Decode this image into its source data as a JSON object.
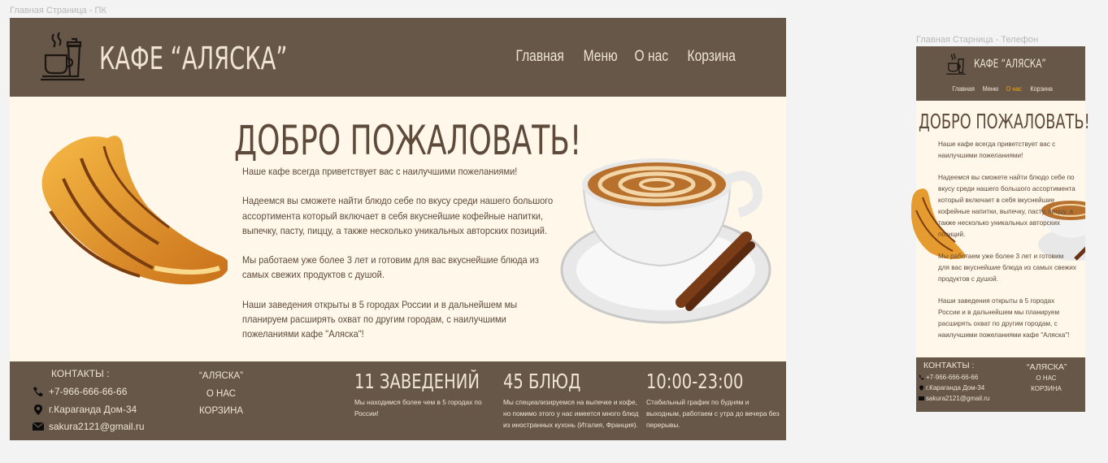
{
  "frames": {
    "pc_label": "Главная Страница - ПК",
    "phone_label": "Главная Старница - Телефон"
  },
  "header": {
    "title": "КАФЕ “АЛЯСКА”",
    "logo_icon": "cafe-logo-icon",
    "nav": [
      "Главная",
      "Меню",
      "О нас",
      "Корзина"
    ],
    "phone_active_nav": "О нас"
  },
  "main": {
    "welcome": "ДОБРО ПОЖАЛОВАТЬ!",
    "paragraphs": [
      "Наше кафе всегда приветствует вас с наилучшими пожеланиями!",
      "Надеемся вы сможете найти блюдо себе по вкусу среди нашего большого ассортимента который включает в себя вкуснейшие кофейные напитки, выпечку, пасту, пиццу, а также несколько уникальных авторских позиций.",
      "Мы работаем уже более 3 лет и готовим для вас вкуснейшие блюда из самых свежих продуктов с душой.",
      "Наши заведения открыты в 5 городах России и в дальнейшем мы планируем расширять охват по другим городам, с наилучшими пожеланиями кафе \"Аляска\"!"
    ]
  },
  "footer": {
    "contacts_title": "КОНТАКТЫ :",
    "phone": "+7-966-666-66-66",
    "address": "г.Караганда Дом-34",
    "email": "sakura2121@gmail.ru",
    "brand": "“АЛЯСКА”",
    "about": "О НАС",
    "cart": "КОРЗИНА",
    "stats": [
      {
        "title": "11 ЗАВЕДЕНИЙ",
        "desc": "Мы находимся более чем в 5 городах по России!"
      },
      {
        "title": "45 БЛЮД",
        "desc": "Мы специализируемся на выпечке и кофе, но помимо этого у нас имеется много блюд из иностранных кухонь (Италия, Франция)."
      },
      {
        "title": "10:00-23:00",
        "desc": "Стабильный график по будням и выходным, работаем с утра до вечера без перерывы."
      }
    ]
  },
  "colors": {
    "brown": "#665749",
    "cream": "#fff7e9",
    "text": "#5d4a3b",
    "accent": "#e3a937"
  }
}
